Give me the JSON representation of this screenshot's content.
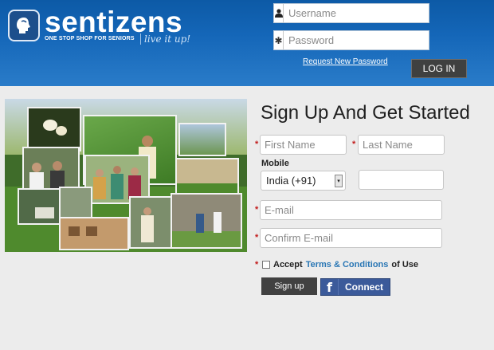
{
  "header": {
    "brand": "sentizens",
    "tagline": "ONE STOP SHOP FOR SENIORS",
    "script_tag": "live it up!",
    "username_placeholder": "Username",
    "password_placeholder": "Password",
    "request_password_link": "Request New Password",
    "login_label": "LOG IN"
  },
  "signup": {
    "title": "Sign Up And Get Started",
    "first_name_placeholder": "First Name",
    "last_name_placeholder": "Last Name",
    "mobile_label": "Mobile",
    "country_value": "India (+91)",
    "mobile_value": "",
    "email_placeholder": "E-mail",
    "confirm_email_placeholder": "Confirm E-mail",
    "required_mark": "*",
    "accept_prefix": "Accept",
    "terms_link": "Terms & Conditions",
    "accept_suffix": "of Use",
    "signup_label": "Sign up",
    "connect_label": "Connect",
    "facebook_glyph": "f"
  },
  "icons": {
    "user": "user-icon",
    "password": "asterisk-icon"
  },
  "colors": {
    "header_blue": "#1466b8",
    "button_dark": "#414141",
    "facebook_blue": "#3b5a9a",
    "terms_link": "#2a77b5",
    "required_red": "#c21a1a"
  }
}
